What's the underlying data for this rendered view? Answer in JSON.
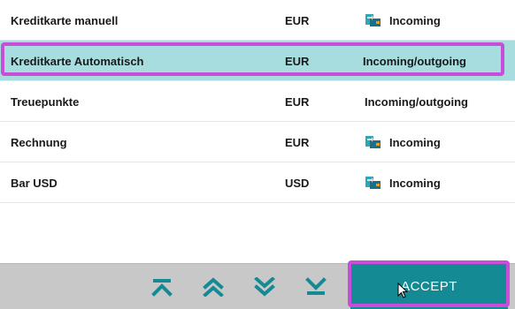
{
  "rows": [
    {
      "name": "Kreditkarte manuell",
      "currency": "EUR",
      "direction": "Incoming",
      "icon": "incoming-wallet-icon",
      "selected": false
    },
    {
      "name": "Kreditkarte Automatisch",
      "currency": "EUR",
      "direction": "Incoming/outgoing",
      "icon": null,
      "selected": true
    },
    {
      "name": "Treuepunkte",
      "currency": "EUR",
      "direction": "Incoming/outgoing",
      "icon": null,
      "selected": false
    },
    {
      "name": "Rechnung",
      "currency": "EUR",
      "direction": "Incoming",
      "icon": "incoming-wallet-icon",
      "selected": false
    },
    {
      "name": "Bar USD",
      "currency": "USD",
      "direction": "Incoming",
      "icon": "incoming-wallet-icon",
      "selected": false
    }
  ],
  "footer": {
    "nav": [
      {
        "icon": "scroll-to-top-icon"
      },
      {
        "icon": "page-up-icon"
      },
      {
        "icon": "page-down-icon"
      },
      {
        "icon": "scroll-to-bottom-icon"
      }
    ],
    "accept_label": "ACCEPT"
  },
  "colors": {
    "selected_row": "#a8dde0",
    "accent": "#148a95",
    "highlight_outline": "#c74ed8",
    "footer_bg": "#c8c8c8"
  }
}
